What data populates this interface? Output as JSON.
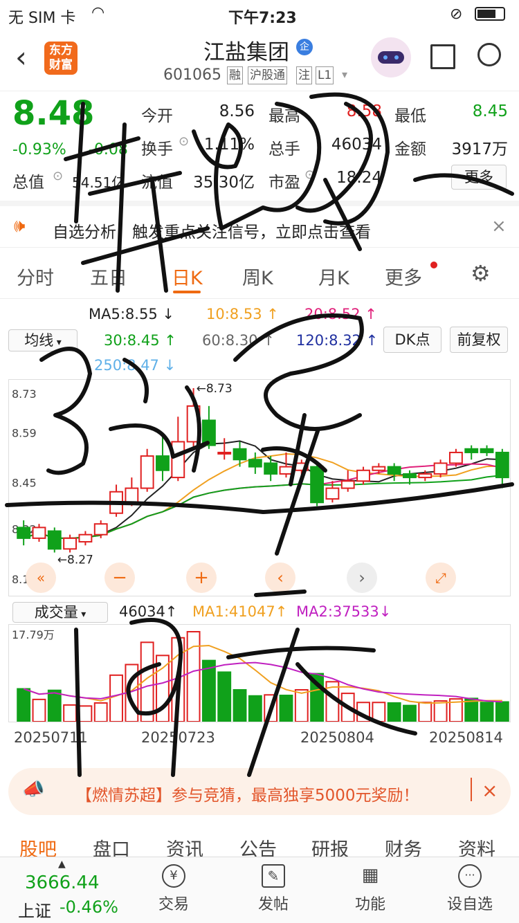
{
  "status": {
    "carrier": "无 SIM 卡",
    "time": "下午7:23"
  },
  "header": {
    "logo_line1": "东方",
    "logo_line2": "财富",
    "title": "江盐集团",
    "badge": "企",
    "code": "601065",
    "tags": [
      "融",
      "沪股通",
      "注",
      "L1"
    ]
  },
  "quote": {
    "price": "8.48",
    "change_pct": "-0.93%",
    "change": "-0.08",
    "open_label": "今开",
    "open": "8.56",
    "high_label": "最高",
    "high": "8.58",
    "low_label": "最低",
    "low": "8.45",
    "turnover_label": "换手",
    "turnover": "1.11%",
    "volume_label": "总手",
    "volume": "46034",
    "amount_label": "金额",
    "amount": "3917万",
    "mcap_label": "总值",
    "mcap": "54.51亿",
    "float_label": "流值",
    "float": "35.30亿",
    "pe_label": "市盈",
    "pe": "18.24",
    "more": "更多"
  },
  "notice": {
    "text": "自选分析：触发重点关注信号，立即点击查看",
    "close": "×"
  },
  "tabs": [
    {
      "label": "分时"
    },
    {
      "label": "五日"
    },
    {
      "label": "日K"
    },
    {
      "label": "周K"
    },
    {
      "label": "月K"
    },
    {
      "label": "更多"
    }
  ],
  "ma": {
    "ma5": "MA5:8.55 ↓",
    "ma10": "10:8.53 ↑",
    "ma20": "20:8.52 ↑",
    "ma30": "30:8.45 ↑",
    "ma60": "60:8.30 ↑",
    "ma120": "120:8.32 ↑",
    "ma250": "250:8.47 ↓",
    "select": "均线",
    "dk": "DK点",
    "fq": "前复权",
    "color5": "#222222",
    "color10": "#f0a020",
    "color20": "#e0207a",
    "color30": "#10a11a",
    "color60": "#888888",
    "color120": "#2030a0",
    "color250": "#5fb0e8"
  },
  "chart_data": {
    "type": "candlestick",
    "ylim": [
      8.18,
      8.73
    ],
    "yticks": [
      "8.73",
      "8.59",
      "8.45",
      "8.32",
      "8.18"
    ],
    "max_label": "←8.73",
    "min_label": "←8.27",
    "candles": [
      {
        "o": 8.34,
        "c": 8.31,
        "h": 8.36,
        "l": 8.29
      },
      {
        "o": 8.31,
        "c": 8.34,
        "h": 8.35,
        "l": 8.3
      },
      {
        "o": 8.33,
        "c": 8.28,
        "h": 8.34,
        "l": 8.27
      },
      {
        "o": 8.28,
        "c": 8.31,
        "h": 8.32,
        "l": 8.27
      },
      {
        "o": 8.3,
        "c": 8.32,
        "h": 8.33,
        "l": 8.29
      },
      {
        "o": 8.32,
        "c": 8.35,
        "h": 8.36,
        "l": 8.31
      },
      {
        "o": 8.38,
        "c": 8.44,
        "h": 8.46,
        "l": 8.37
      },
      {
        "o": 8.41,
        "c": 8.45,
        "h": 8.48,
        "l": 8.4
      },
      {
        "o": 8.45,
        "c": 8.54,
        "h": 8.56,
        "l": 8.44
      },
      {
        "o": 8.54,
        "c": 8.5,
        "h": 8.6,
        "l": 8.47
      },
      {
        "o": 8.48,
        "c": 8.58,
        "h": 8.65,
        "l": 8.47
      },
      {
        "o": 8.58,
        "c": 8.68,
        "h": 8.73,
        "l": 8.56
      },
      {
        "o": 8.64,
        "c": 8.57,
        "h": 8.68,
        "l": 8.56
      },
      {
        "o": 8.55,
        "c": 8.55,
        "h": 8.59,
        "l": 8.53
      },
      {
        "o": 8.56,
        "c": 8.53,
        "h": 8.58,
        "l": 8.51
      },
      {
        "o": 8.53,
        "c": 8.51,
        "h": 8.55,
        "l": 8.49
      },
      {
        "o": 8.52,
        "c": 8.49,
        "h": 8.54,
        "l": 8.47
      },
      {
        "o": 8.49,
        "c": 8.51,
        "h": 8.55,
        "l": 8.48
      },
      {
        "o": 8.5,
        "c": 8.52,
        "h": 8.53,
        "l": 8.48
      },
      {
        "o": 8.51,
        "c": 8.41,
        "h": 8.52,
        "l": 8.4
      },
      {
        "o": 8.42,
        "c": 8.45,
        "h": 8.47,
        "l": 8.41
      },
      {
        "o": 8.45,
        "c": 8.47,
        "h": 8.5,
        "l": 8.44
      },
      {
        "o": 8.47,
        "c": 8.5,
        "h": 8.51,
        "l": 8.46
      },
      {
        "o": 8.5,
        "c": 8.51,
        "h": 8.52,
        "l": 8.49
      },
      {
        "o": 8.51,
        "c": 8.49,
        "h": 8.52,
        "l": 8.47
      },
      {
        "o": 8.49,
        "c": 8.48,
        "h": 8.5,
        "l": 8.46
      },
      {
        "o": 8.48,
        "c": 8.49,
        "h": 8.5,
        "l": 8.47
      },
      {
        "o": 8.49,
        "c": 8.52,
        "h": 8.53,
        "l": 8.48
      },
      {
        "o": 8.52,
        "c": 8.55,
        "h": 8.56,
        "l": 8.51
      },
      {
        "o": 8.56,
        "c": 8.55,
        "h": 8.57,
        "l": 8.53
      },
      {
        "o": 8.56,
        "c": 8.55,
        "h": 8.57,
        "l": 8.54
      },
      {
        "o": 8.55,
        "c": 8.48,
        "h": 8.56,
        "l": 8.45
      }
    ],
    "volume": {
      "ylabel": "17.79万",
      "values": [
        6.5,
        4.4,
        6.2,
        3.3,
        3.1,
        3.7,
        9.2,
        11.3,
        15.7,
        13.1,
        16.6,
        17.8,
        12.1,
        9.8,
        6.3,
        5.1,
        5.3,
        5.2,
        6.3,
        9.5,
        7.9,
        5.6,
        3.8,
        3.8,
        3.7,
        3.2,
        3.8,
        4.1,
        4.5,
        4.6,
        3.8,
        3.9
      ],
      "up": [
        false,
        true,
        false,
        true,
        true,
        true,
        true,
        true,
        true,
        true,
        true,
        true,
        false,
        false,
        false,
        false,
        true,
        false,
        true,
        false,
        true,
        true,
        true,
        true,
        false,
        false,
        true,
        true,
        true,
        false,
        false,
        false
      ]
    },
    "x_ticks": [
      "20250711",
      "20250723",
      "20250804",
      "20250814"
    ]
  },
  "vol": {
    "select": "成交量",
    "vol": "46034↑",
    "ma1": "MA1:41047↑",
    "ma2": "MA2:37533↓"
  },
  "banner": {
    "text": "【燃情苏超】参与竞猜，最高独享5000元奖励！",
    "close": "×"
  },
  "bottom_tabs": [
    "股吧",
    "盘口",
    "资讯",
    "公告",
    "研报",
    "财务",
    "资料"
  ],
  "footer": {
    "index_value": "3666.44",
    "index_name": "上证",
    "index_change": "-0.46%",
    "items": [
      {
        "label": "交易"
      },
      {
        "label": "发帖"
      },
      {
        "label": "功能"
      },
      {
        "label": "设自选"
      }
    ]
  },
  "handwriting": [
    "华",
    "强",
    "3",
    "弘",
    "多",
    "+",
    "1",
    "9",
    "大"
  ]
}
